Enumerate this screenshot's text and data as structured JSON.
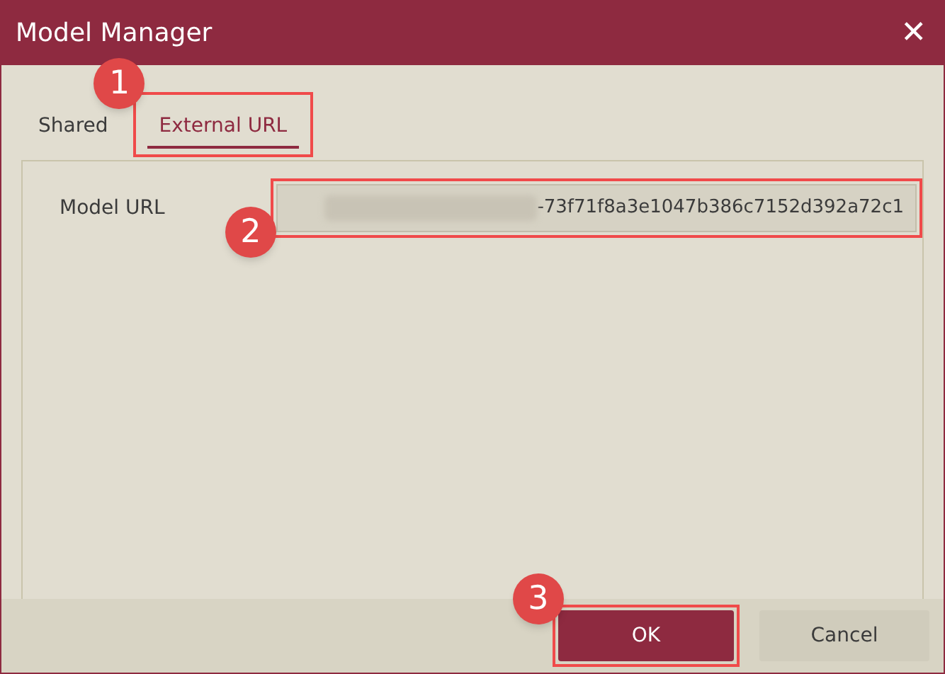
{
  "window": {
    "title": "Model Manager",
    "close_glyph": "✕"
  },
  "tabs": [
    {
      "label": "Shared",
      "selected": false
    },
    {
      "label": "External URL",
      "selected": true,
      "step": "1"
    }
  ],
  "fields": [
    {
      "label": "Model URL",
      "value": "-73f71f8a3e1047b386c7152d392a72c1",
      "redacted_prefix": true,
      "step": "2"
    }
  ],
  "buttons": [
    {
      "label": "OK",
      "kind": "primary",
      "step": "3"
    },
    {
      "label": "Cancel",
      "kind": "secondary"
    }
  ]
}
